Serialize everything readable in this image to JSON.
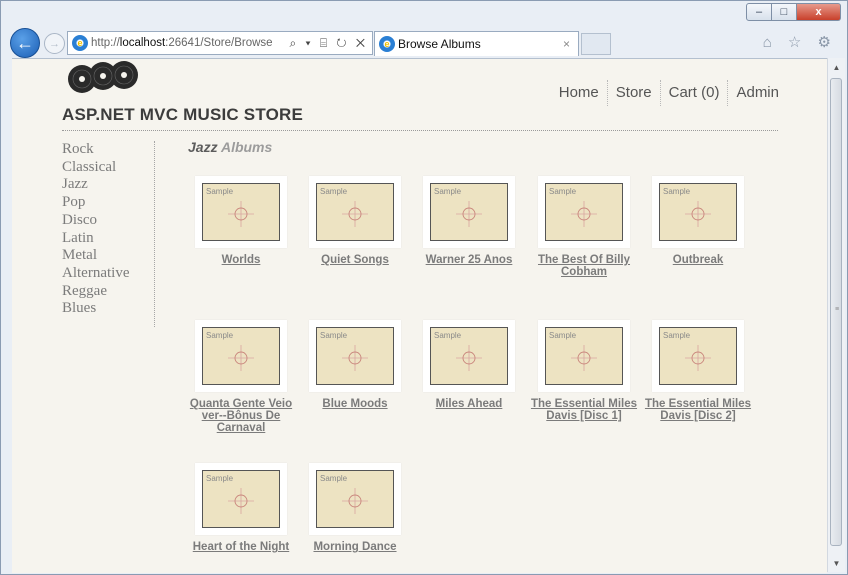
{
  "browser": {
    "address_prefix": "http://",
    "address_host": "localhost",
    "address_rest": ":26641/Store/Browse",
    "address_tools": "⌕ ▾ ⌸ ↻ ✕",
    "tab_title": "Browse Albums",
    "tab_close": "×",
    "right_icons": "⌂ ☆ ⚙",
    "min": "–",
    "max": "□",
    "close": "x",
    "back": "←",
    "forward": "→"
  },
  "site": {
    "title": "ASP.NET MVC MUSIC STORE",
    "nav": [
      "Home",
      "Store",
      "Cart (0)",
      "Admin"
    ]
  },
  "genres": [
    "Rock",
    "Classical",
    "Jazz",
    "Pop",
    "Disco",
    "Latin",
    "Metal",
    "Alternative",
    "Reggae",
    "Blues"
  ],
  "heading": {
    "genre": "Jazz",
    "suffix": "Albums"
  },
  "thumb_text": "Sample",
  "albums": [
    {
      "title": "Worlds"
    },
    {
      "title": "Quiet Songs"
    },
    {
      "title": "Warner 25 Anos"
    },
    {
      "title": "The Best Of Billy Cobham"
    },
    {
      "title": "Outbreak"
    },
    {
      "title": "Quanta Gente Veio ver--Bônus De Carnaval"
    },
    {
      "title": "Blue Moods"
    },
    {
      "title": "Miles Ahead"
    },
    {
      "title": "The Essential Miles Davis [Disc 1]"
    },
    {
      "title": "The Essential Miles Davis [Disc 2]"
    },
    {
      "title": "Heart of the Night"
    },
    {
      "title": "Morning Dance"
    }
  ]
}
